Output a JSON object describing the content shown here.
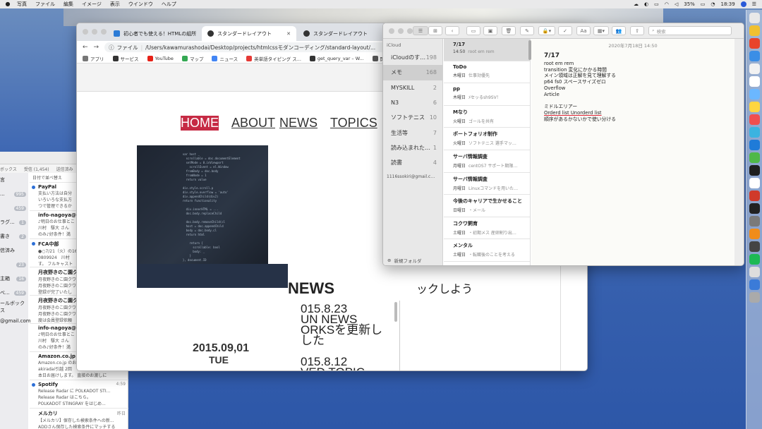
{
  "menubar": {
    "items": [
      "写真",
      "ファイル",
      "編集",
      "イメージ",
      "表示",
      "ウインドウ",
      "ヘルプ"
    ],
    "battery": "35%",
    "time": "18:39"
  },
  "mail": {
    "mailbox_label": "ボックス",
    "tabs": [
      "受信 (1,454)",
      "送信済み"
    ],
    "sort": "日付で並べ替え",
    "side": [
      {
        "label": "言",
        "count": ""
      },
      {
        "label": "...",
        "count": "995"
      },
      {
        "label": "",
        "count": "459"
      },
      {
        "label": "ラグ...",
        "count": "1"
      },
      {
        "label": "書き",
        "count": "2"
      },
      {
        "label": "信済み",
        "count": ""
      },
      {
        "label": "",
        "count": "23"
      },
      {
        "label": "主箱",
        "count": "16"
      },
      {
        "label": "べ...",
        "count": "459"
      },
      {
        "label": "ールボックス",
        "count": ""
      },
      {
        "label": "@gmail.com",
        "count": ""
      }
    ],
    "items": [
      {
        "from": "PayPal",
        "lines": [
          "支払い方法は自分",
          "いろいろな支払方",
          "つで管理できるか"
        ],
        "date": "",
        "unread": true
      },
      {
        "from": "info-nagoya@as",
        "lines": [
          "♪明日のお仕事とこ",
          "川村　駆大 さん",
          "のみ♪好条件！満"
        ],
        "date": "",
        "unread": false
      },
      {
        "from": "FCA中部",
        "lines": [
          "●○7/21（火）の16",
          "0809924　川村",
          "す。 フルキャスト"
        ],
        "date": "",
        "unread": true
      },
      {
        "from": "月夜野きのこ園クワ",
        "lines": [
          "月夜野きのこ園クワ",
          "月夜野きのこ園クワ",
          "登録が完了いたし"
        ],
        "date": "",
        "unread": false
      },
      {
        "from": "月夜野きのこ園クワ",
        "lines": [
          "月夜野きのこ園クワ",
          "月夜野きのこ園クワ",
          "度は会員登録依頼"
        ],
        "date": "",
        "unread": false
      },
      {
        "from": "info-nagoya@as",
        "lines": [
          "♪明日のお仕事とこ",
          "川村　駆大 さん",
          "のみ♪好条件！満"
        ],
        "date": "",
        "unread": false
      },
      {
        "from": "Amazon.co.jp",
        "lines": [
          "Amazon.co.jp のお",
          "akiradai引越 2回",
          "本日お届けします。 直接のお渡しに"
        ],
        "date": "",
        "unread": false
      },
      {
        "from": "Spotify",
        "lines": [
          "Release Radar に POLKADOT STI...",
          "Release Radar はこちら。",
          "POLKADOT STINGRAY をはじめ..."
        ],
        "date": "4:59",
        "unread": true
      },
      {
        "from": "メルカリ",
        "lines": [
          "【メルカリ】保存した検索条件への新...",
          "ADDさん保存した検索条件にマッチする"
        ],
        "date": "昨日",
        "unread": false
      }
    ]
  },
  "chrome": {
    "tabs": [
      {
        "title": "初心者でも使える！HTMLの組所",
        "favicon": "#2b7bd6"
      },
      {
        "title": "スタンダードレイアウト",
        "favicon": "#333333"
      },
      {
        "title": "スタンダードレイアウト",
        "favicon": "#333333"
      }
    ],
    "url_scheme": "ファイル",
    "url": "/Users/kawamurashodai/Desktop/projects/htmlcssモダンコーディング/standard-layout/...",
    "bookmarks": [
      {
        "label": "アプリ",
        "color": "#777777"
      },
      {
        "label": "サービス",
        "color": "#333333"
      },
      {
        "label": "YouTube",
        "color": "#e62117"
      },
      {
        "label": "マップ",
        "color": "#34a853"
      },
      {
        "label": "ニュース",
        "color": "#4285f4"
      },
      {
        "label": "英単語タイピング ス...",
        "color": "#e53935"
      },
      {
        "label": "get_query_var – W...",
        "color": "#333333"
      },
      {
        "label": "開発",
        "color": "#555555"
      }
    ],
    "page": {
      "nav": [
        "HOME",
        "ABOUT",
        "NEWS",
        "TOPICS"
      ],
      "news_heading": "NEWS",
      "news_lines": [
        "015.8.23",
        "UN NEWS",
        "ORKSを更新し",
        "した",
        "",
        "015.8.12",
        "VED TOPIC",
        "SSでてこまでで"
      ],
      "date": "2015.09,01",
      "weekday": "TUE",
      "right_text": "ックしよう"
    }
  },
  "notes": {
    "search_placeholder": "検索",
    "icloud_header": "iCloud",
    "folders": [
      {
        "label": "iCloudのす…",
        "count": "198",
        "selected": false
      },
      {
        "label": "メモ",
        "count": "168",
        "selected": true
      },
      {
        "label": "MYSKILL",
        "count": "2",
        "selected": false
      },
      {
        "label": "N3",
        "count": "6",
        "selected": false
      },
      {
        "label": "ソフトテニス",
        "count": "10",
        "selected": false
      },
      {
        "label": "生活等",
        "count": "7",
        "selected": false
      },
      {
        "label": "読み込まれた…",
        "count": "1",
        "selected": false
      },
      {
        "label": "読書",
        "count": "4",
        "selected": false
      }
    ],
    "account": "1116ssokiri@gmail.c…",
    "new_folder": "新規フォルダ",
    "list": [
      {
        "title": "7/17",
        "day": "14:50",
        "preview": "root em rem",
        "selected": true
      },
      {
        "title": "ToDo",
        "day": "木曜日",
        "preview": "仕事効優先",
        "selected": false
      },
      {
        "title": "pp",
        "day": "木曜日",
        "preview": "ﾒセッるsh9SV！",
        "selected": false
      },
      {
        "title": "Mなり",
        "day": "火曜日",
        "preview": "ゴールを共有",
        "selected": false
      },
      {
        "title": "ポートフォリオ制作",
        "day": "火曜日",
        "preview": "ソフトテニス 選手マッ…",
        "selected": false
      },
      {
        "title": "サーバ情報調査",
        "day": "月曜日",
        "preview": "centOS7 サポート期限…",
        "selected": false
      },
      {
        "title": "サーバ情報調査",
        "day": "月曜日",
        "preview": "Linuxコマンドを用いた…",
        "selected": false
      },
      {
        "title": "今後のキャリアで生かせること",
        "day": "日曜日",
        "preview": "・メール",
        "selected": false
      },
      {
        "title": "コクワ飼育",
        "day": "土曜日",
        "preview": "・初期メス 産卵割り出…",
        "selected": false
      },
      {
        "title": "メンタル",
        "day": "土曜日",
        "preview": "・転職後のことを考える",
        "selected": false
      }
    ],
    "editor": {
      "timestamp": "2020年7月18日 14:50",
      "title": "7/17",
      "lines": [
        "root em rem",
        "transition 変化にかかる時間",
        "メイン領域は正解を見て理解する",
        "p64 fs0 スペースサイズゼロ",
        "Overflow",
        "Article",
        "",
        "ミドルエリアー",
        "Orderd list Unorderd list",
        "順序があるかないかで使い分ける"
      ]
    }
  }
}
